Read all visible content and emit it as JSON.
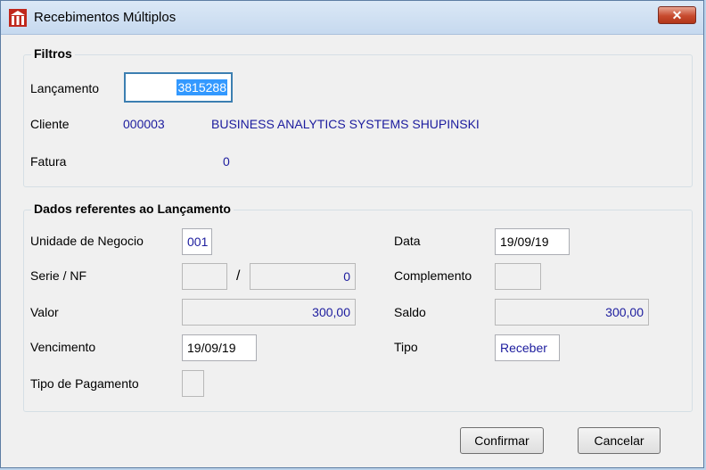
{
  "window": {
    "title": "Recebimentos Múltiplos",
    "close_glyph": "✕"
  },
  "colors": {
    "title_bar": "#c6d9ef",
    "value_text": "#1c1c9e",
    "close_button": "#c74a2e",
    "selection": "#3399ff"
  },
  "filtros": {
    "title": "Filtros",
    "lancamento_label": "Lançamento",
    "lancamento_value": "3815288",
    "cliente_label": "Cliente",
    "cliente_code": "000003",
    "cliente_name": "BUSINESS ANALYTICS SYSTEMS SHUPINSKI",
    "fatura_label": "Fatura",
    "fatura_value": "0"
  },
  "dados": {
    "title": "Dados referentes ao Lançamento",
    "unidade_label": "Unidade de Negocio",
    "unidade_value": "001",
    "serie_label": "Serie / NF",
    "serie_value": "",
    "separator": "/",
    "nf_value": "0",
    "valor_label": "Valor",
    "valor_value": "300,00",
    "vencimento_label": "Vencimento",
    "vencimento_value": "19/09/19",
    "tipo_pagamento_label": "Tipo de Pagamento",
    "tipo_pagamento_value": "",
    "data_label": "Data",
    "data_value": "19/09/19",
    "complemento_label": "Complemento",
    "complemento_value": "",
    "saldo_label": "Saldo",
    "saldo_value": "300,00",
    "tipo_label": "Tipo",
    "tipo_value": "Receber"
  },
  "buttons": {
    "confirmar": "Confirmar",
    "cancelar": "Cancelar"
  }
}
